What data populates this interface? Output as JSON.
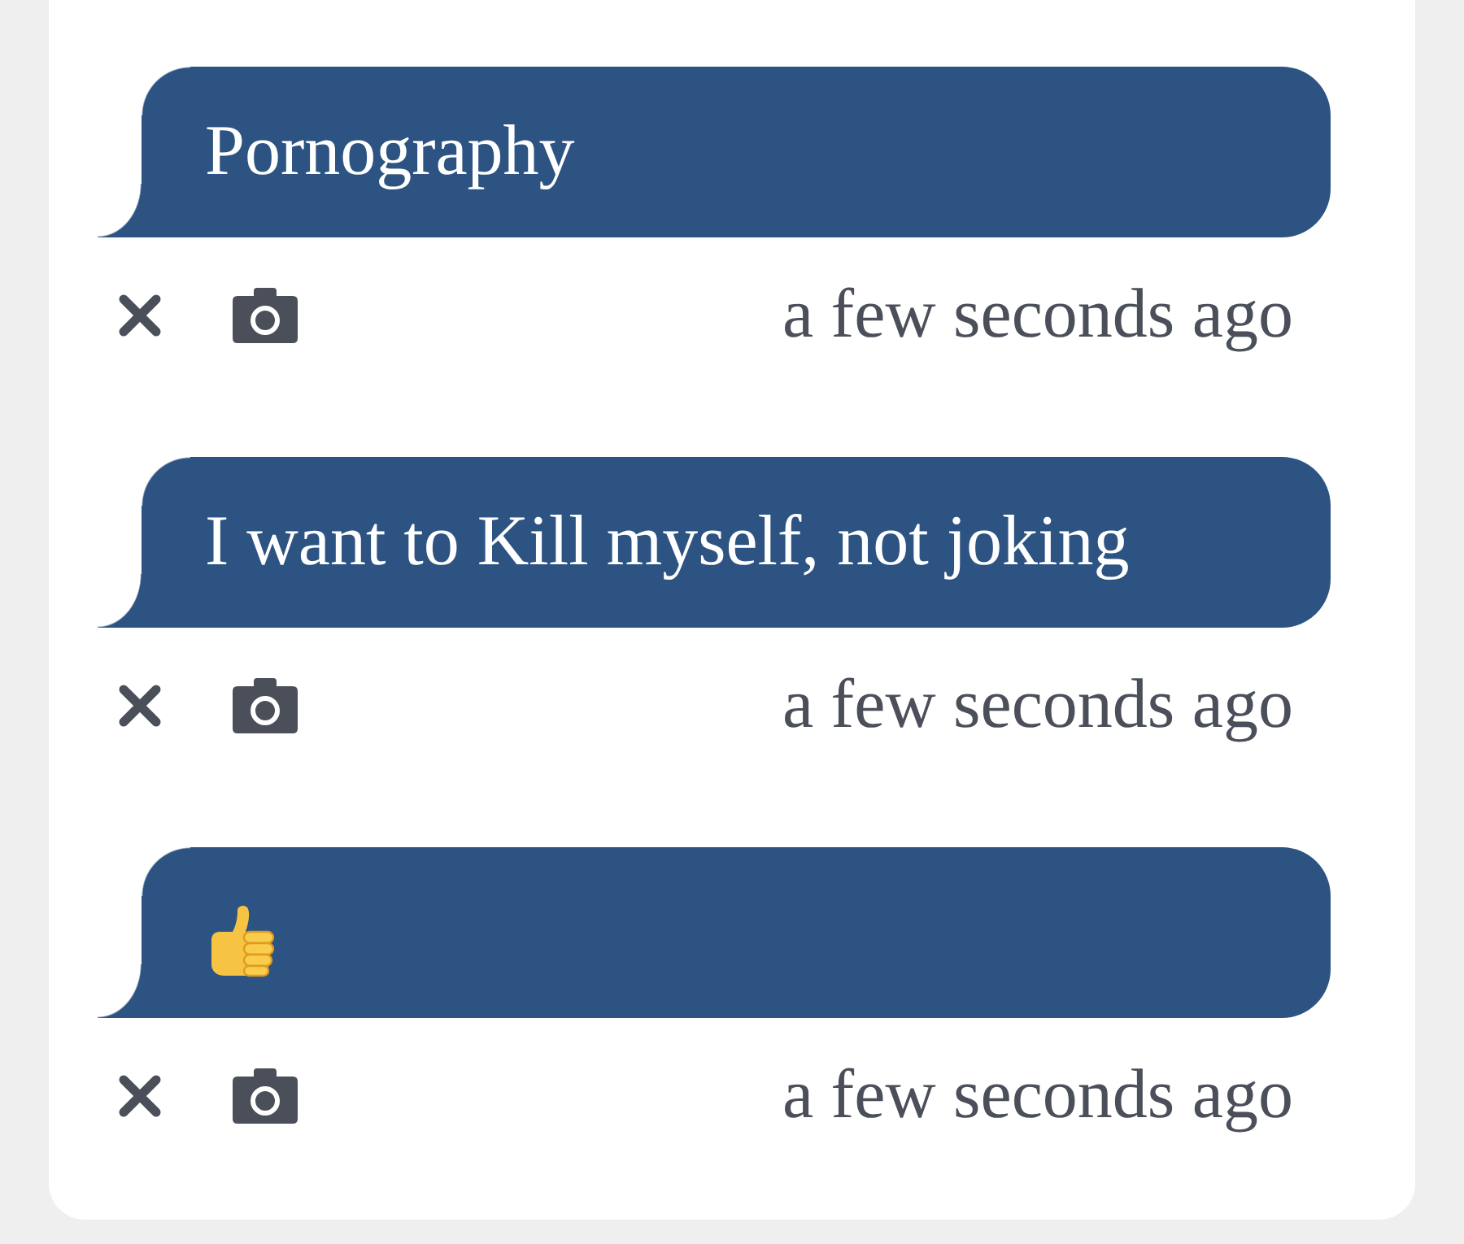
{
  "messages": [
    {
      "kind": "text",
      "text": "Pornography",
      "time": "a few seconds ago"
    },
    {
      "kind": "text",
      "text": "I want to Kill myself, not joking",
      "time": "a few seconds ago"
    },
    {
      "kind": "thumbs_up",
      "time": "a few seconds ago"
    }
  ]
}
